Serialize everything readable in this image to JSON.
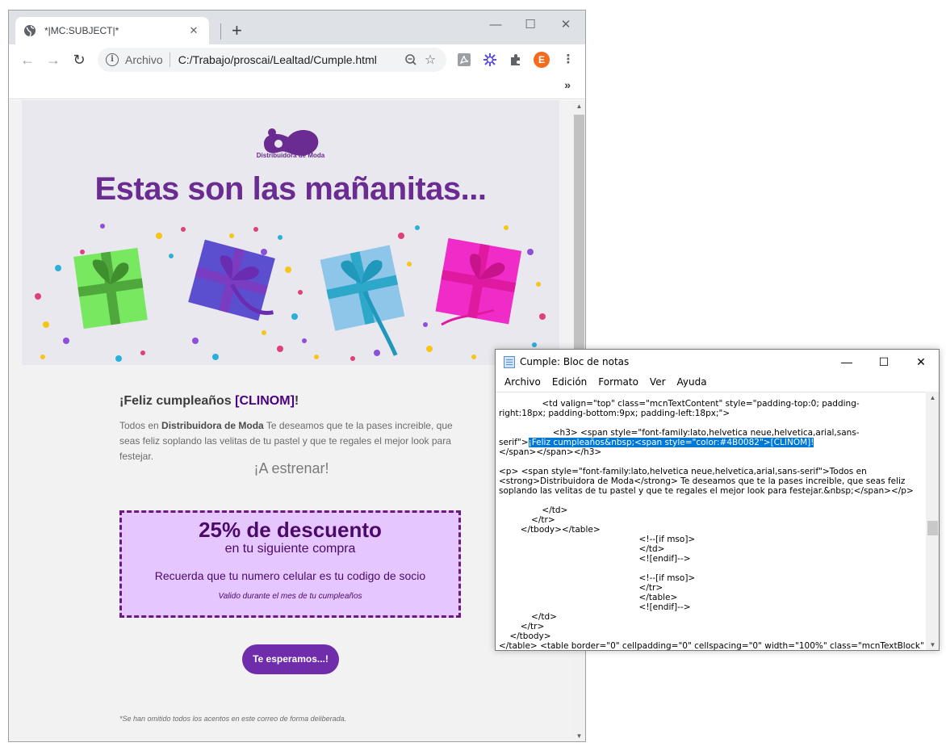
{
  "browser": {
    "tab_title": "*|MC:SUBJECT|*",
    "new_tab_glyph": "+",
    "url_scheme": "Archivo",
    "url": "C:/Trabajo/proscai/Lealtad/Cumple.html",
    "icons": [
      "globe-icon",
      "close-icon",
      "back-icon",
      "forward-icon",
      "reload-icon",
      "info-icon",
      "zoom-icon",
      "star-icon",
      "pdf-extension-icon",
      "extension-icon",
      "puzzle-icon",
      "avatar"
    ],
    "avatar_initial": "E",
    "overflow_glyph": "»"
  },
  "email": {
    "logo_text": "Distribuidora de Moda",
    "hero_title": "Estas son las mañanitas...",
    "greeting_prefix": "¡Feliz cumpleaños ",
    "greeting_name": "[CLINOM]",
    "greeting_suffix": "!",
    "body_prefix": "Todos en ",
    "body_strong": "Distribuidora de Moda",
    "body_text": " Te deseamos que te la pases increible, que seas feliz soplando las velitas de tu pastel y que te regales el mejor look para festejar.",
    "estrenar": "¡A estrenar!",
    "coupon": {
      "title": "25% de descuento",
      "subtitle": "en tu siguiente compra",
      "note": "Recuerda que tu numero celular es tu codigo de socio",
      "valid": "Valido durante el mes de tu cumpleaños"
    },
    "cta_label": "Te esperamos...!",
    "footnote": "*Se han omitido todos los acentos en este correo de forma deliberada.",
    "colors": {
      "purple": "#6b2c91",
      "coupon_bg": "#e5c6ff",
      "cta": "#6f2dac",
      "name": "#4b0082"
    }
  },
  "notepad": {
    "title": "Cumple: Bloc de notas",
    "menu": [
      "Archivo",
      "Edición",
      "Formato",
      "Ver",
      "Ayuda"
    ],
    "code_lines": [
      "                <td valign=\"top\" class=\"mcnTextContent\" style=\"padding-top:0; padding-",
      "right:18px; padding-bottom:9px; padding-left:18px;\">",
      "",
      "                    <h3> <span style=\"font-family:lato,helvetica neue,helvetica,arial,sans-"
    ],
    "code_sel_prefix": "serif\">",
    "code_selected": "¡Feliz cumpleaños&nbsp;<span style=\"color:#4B0082\">[CLINOM]!",
    "code_lines_after": [
      "</span></span></h3>",
      "",
      "<p> <span style=\"font-family:lato,helvetica neue,helvetica,arial,sans-serif\">Todos en",
      "<strong>Distribuidora de Moda</strong> Te deseamos que te la pases increible, que seas feliz",
      "soplando las velitas de tu pastel y que te regales el mejor look para festejar.&nbsp;</span></p>",
      "",
      "                </td>",
      "            </tr>",
      "        </tbody></table>",
      "                                                    <!--[if mso]>",
      "                                                    </td>",
      "                                                    <![endif]-->",
      "",
      "                                                    <!--[if mso]>",
      "                                                    </tr>",
      "                                                    </table>",
      "                                                    <![endif]-->",
      "            </td>",
      "        </tr>",
      "    </tbody>",
      "</table> <table border=\"0\" cellpadding=\"0\" cellspacing=\"0\" width=\"100%\" class=\"mcnTextBlock\""
    ]
  }
}
